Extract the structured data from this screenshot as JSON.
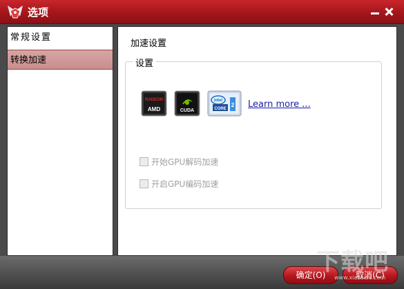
{
  "window": {
    "title": "选项",
    "accent": "#a3161b"
  },
  "sidebar": {
    "items": [
      {
        "label": "常规设置",
        "selected": false
      },
      {
        "label": "转换加速",
        "selected": true
      }
    ]
  },
  "main": {
    "panel_title": "加速设置",
    "group_legend": "设置",
    "hardware_badges": [
      {
        "name": "amd-radeon-logo",
        "text": "AMD"
      },
      {
        "name": "nvidia-cuda-logo",
        "text": "CUDA"
      },
      {
        "name": "intel-core-logo",
        "text": "CORE"
      }
    ],
    "learn_more": "Learn more ...",
    "options": [
      {
        "label": "开始GPU解码加速",
        "checked": false,
        "enabled": false
      },
      {
        "label": "开启GPU编码加速",
        "checked": false,
        "enabled": false
      }
    ]
  },
  "footer": {
    "ok_label": "确定(O)",
    "cancel_label": "取消(C)"
  },
  "watermark": {
    "text": "下载吧",
    "sub": "www.xiazaiba.com"
  }
}
